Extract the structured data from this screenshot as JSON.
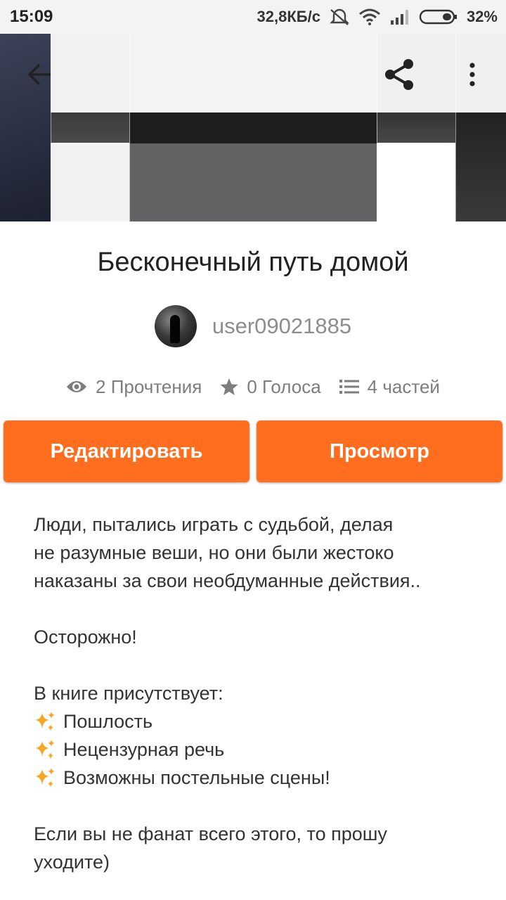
{
  "status_bar": {
    "time": "15:09",
    "speed": "32,8КБ/с",
    "battery": "32%",
    "icons": [
      "alarm-off-icon",
      "wifi-icon",
      "signal-icon",
      "battery-icon"
    ]
  },
  "toolbar": {
    "back_icon": "arrow-left-icon",
    "share_icon": "share-icon",
    "more_icon": "more-vertical-icon"
  },
  "story": {
    "title": "Бесконечный путь домой",
    "author": "user09021885",
    "reads": "2 Прочтения",
    "votes": "0 Голоса",
    "parts": "4 частей"
  },
  "actions": {
    "edit_label": "Редактировать",
    "view_label": "Просмотр"
  },
  "description": {
    "line1": "Люди, пытались играть с судьбой, делая",
    "line2": "не разумные веши, но они были жестоко",
    "line3": "наказаны за свои необдуманные действия..",
    "warning": "Осторожно!",
    "contains": "В книге присутствует:",
    "items": [
      "Пошлость",
      "Нецензурная речь",
      "Возможны постельные сцены!"
    ],
    "outro1": "Если вы не фанат всего этого, то прошу",
    "outro2": "уходите)"
  },
  "colors": {
    "accent": "#ff6d1f",
    "sparkle": "#f5a623"
  }
}
